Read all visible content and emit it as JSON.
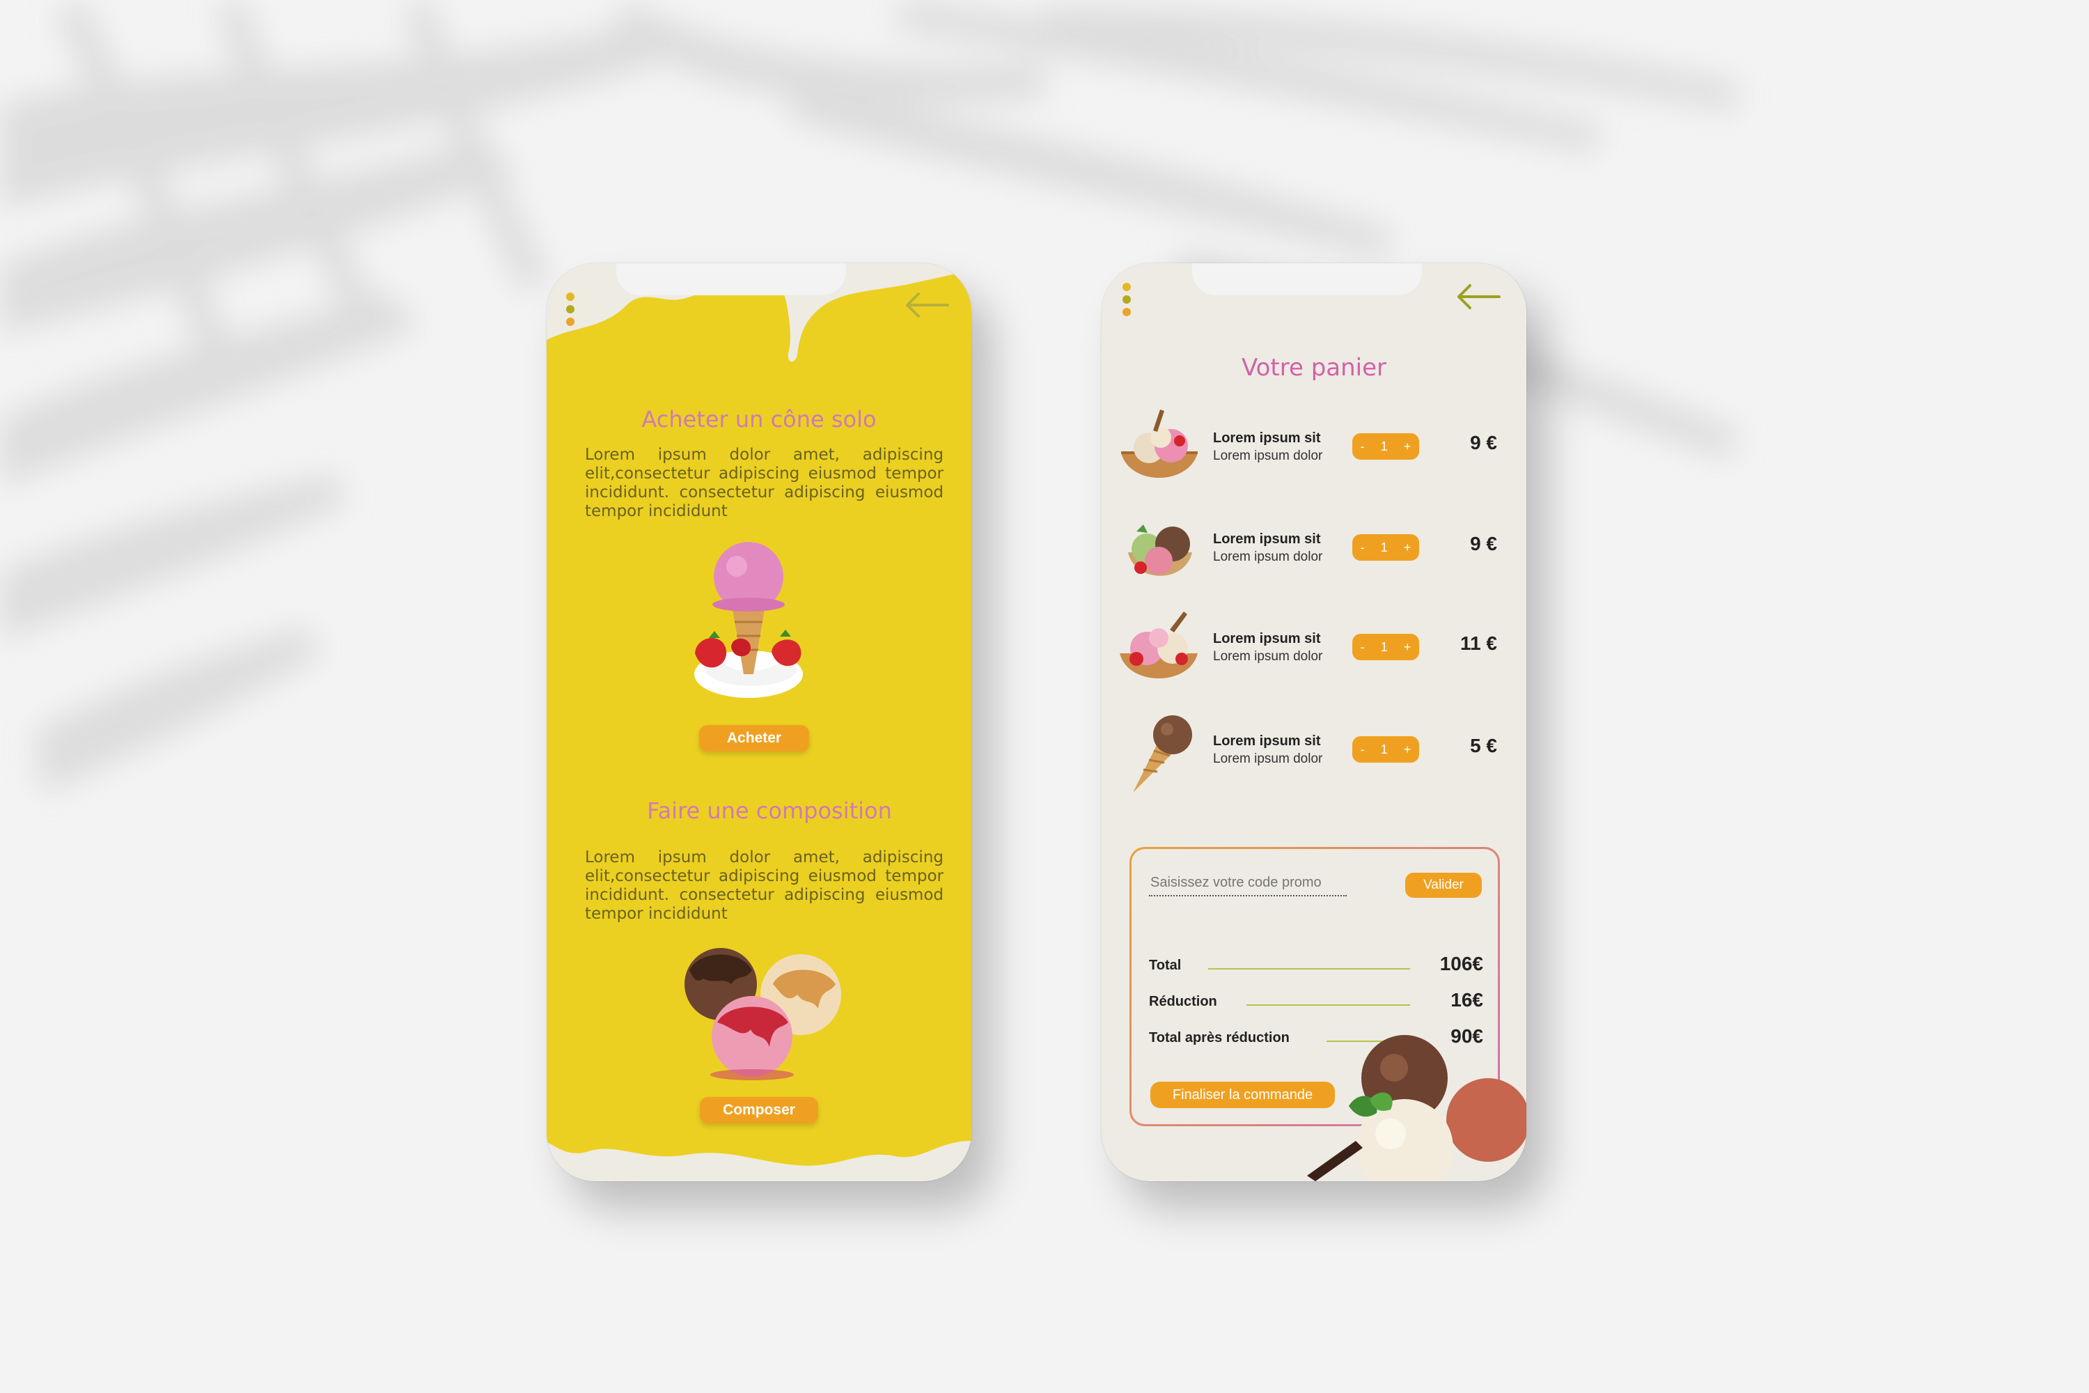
{
  "screen1": {
    "section1": {
      "title": "Acheter un cône solo",
      "text": "Lorem ipsum dolor amet, adipiscing elit,consectetur adipiscing eiusmod tempor incididunt. consectetur adipiscing eiusmod tempor incididunt",
      "button": "Acheter"
    },
    "section2": {
      "title": "Faire une composition",
      "text": "Lorem ipsum dolor amet, adipiscing elit,consectetur adipiscing eiusmod tempor incididunt. consectetur adipiscing eiusmod tempor incididunt",
      "button": "Composer"
    }
  },
  "screen2": {
    "title": "Votre panier",
    "items": [
      {
        "name": "Lorem ipsum sit",
        "desc": "Lorem ipsum dolor",
        "qty": "1",
        "price": "9 €"
      },
      {
        "name": "Lorem ipsum sit",
        "desc": "Lorem ipsum dolor",
        "qty": "1",
        "price": "9 €"
      },
      {
        "name": "Lorem ipsum sit",
        "desc": "Lorem ipsum dolor",
        "qty": "1",
        "price": "11 €"
      },
      {
        "name": "Lorem ipsum sit",
        "desc": "Lorem ipsum dolor",
        "qty": "1",
        "price": "5 €"
      }
    ],
    "stepper": {
      "minus": "-",
      "plus": "+"
    },
    "promo": {
      "placeholder": "Saisissez votre code promo",
      "button": "Valider"
    },
    "summary": {
      "total_label": "Total",
      "total_value": "106€",
      "reduction_label": "Réduction",
      "reduction_value": "16€",
      "after_label": "Total après réduction",
      "after_value": "90€"
    },
    "finalize_button": "Finaliser la commande"
  },
  "colors": {
    "yellow": "#ecd021",
    "orange": "#f0a020",
    "pink": "#d070b0",
    "olive": "#9aa21e"
  }
}
